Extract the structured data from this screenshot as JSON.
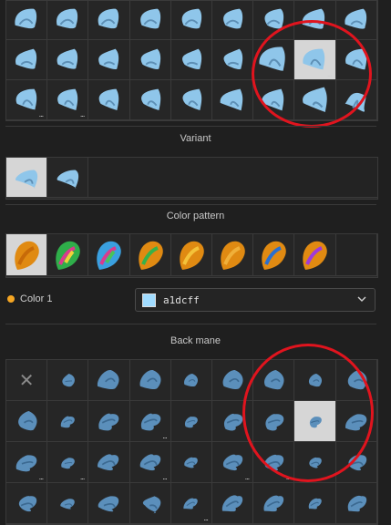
{
  "colors": {
    "mane": "#8fc6ea",
    "mane_dark": "#5d8fb5",
    "back_mane": "#5b8fbb",
    "back_mane_dark": "#3c6a92",
    "accent_dot": "#f5a623",
    "annotation": "#e0141e"
  },
  "top_grid": {
    "cells": [
      {
        "shape": "a"
      },
      {
        "shape": "b"
      },
      {
        "shape": "c"
      },
      {
        "shape": "d"
      },
      {
        "shape": "e"
      },
      {
        "shape": "f"
      },
      {
        "shape": "g"
      },
      {
        "shape": "h"
      },
      {
        "shape": "i"
      },
      {
        "shape": "j"
      },
      {
        "shape": "k"
      },
      {
        "shape": "l"
      },
      {
        "shape": "m"
      },
      {
        "shape": "n"
      },
      {
        "shape": "o"
      },
      {
        "shape": "p",
        "big": true
      },
      {
        "shape": "q",
        "selected": true,
        "dots": true
      },
      {
        "shape": "r"
      },
      {
        "shape": "s",
        "dots": true
      },
      {
        "shape": "t",
        "dots": true
      },
      {
        "shape": "u"
      },
      {
        "shape": "v"
      },
      {
        "shape": "w"
      },
      {
        "shape": "x"
      },
      {
        "shape": "y"
      },
      {
        "shape": "z",
        "big": true
      },
      {
        "shape": "a2"
      }
    ],
    "more_indicator": "..."
  },
  "variant": {
    "title": "Variant",
    "items": [
      {
        "selected": true
      },
      {
        "selected": false
      }
    ]
  },
  "color_pattern": {
    "title": "Color pattern",
    "items": [
      {
        "selected": true,
        "colors": [
          "#e08a12",
          "#c76a08"
        ]
      },
      {
        "selected": false,
        "colors": [
          "#2fae4a",
          "#d93b8e",
          "#f0d23a"
        ]
      },
      {
        "selected": false,
        "colors": [
          "#3aa0e0",
          "#d93b8e",
          "#49c35a"
        ]
      },
      {
        "selected": false,
        "colors": [
          "#e08a12",
          "#36b24a"
        ]
      },
      {
        "selected": false,
        "colors": [
          "#e08a12",
          "#f4c23a"
        ]
      },
      {
        "selected": false,
        "colors": [
          "#e08a12",
          "#f0b03a"
        ]
      },
      {
        "selected": false,
        "colors": [
          "#e08a12",
          "#2a6fcf"
        ]
      },
      {
        "selected": false,
        "colors": [
          "#e08a12",
          "#a03ad9"
        ]
      }
    ]
  },
  "color1": {
    "label": "Color 1",
    "value": "a1dcff",
    "swatch": "#a1dcff"
  },
  "back_mane": {
    "title": "Back mane",
    "rows": [
      [
        "none",
        "b1",
        "b2",
        "b3",
        "b4",
        "b5",
        "b6",
        "b7",
        "b8"
      ],
      [
        "b9",
        "b10",
        "b11",
        "b12",
        "b13",
        "b14",
        "b15",
        "b16",
        "b17"
      ],
      [
        "b18",
        "b19",
        "b20",
        "b21",
        "b22",
        "b23",
        "b24",
        "b25",
        "b26"
      ],
      [
        "b27",
        "b28",
        "b29",
        "b30",
        "b31",
        "b32",
        "b33",
        "b34",
        "b35"
      ]
    ],
    "selected": "b16",
    "with_dots": [
      "b12",
      "b18",
      "b19",
      "b21",
      "b23",
      "b24",
      "b31"
    ]
  }
}
